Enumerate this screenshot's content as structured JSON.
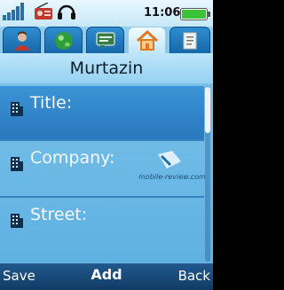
{
  "status_bar": {
    "time": "11:06"
  },
  "tabs": [
    {
      "icon": "contact-person-icon"
    },
    {
      "icon": "globe-icon"
    },
    {
      "icon": "message-icon"
    },
    {
      "icon": "home-icon",
      "active": true
    },
    {
      "icon": "note-icon"
    }
  ],
  "title": "Murtazin",
  "fields": [
    {
      "label": "Title:",
      "icon": "building-icon",
      "selected": true
    },
    {
      "label": "Company:",
      "icon": "building-icon"
    },
    {
      "label": "Street:",
      "icon": "building-icon"
    }
  ],
  "watermark": "mobile-review.com",
  "softkeys": {
    "left": "Save",
    "middle": "Add",
    "right": "Back"
  },
  "colors": {
    "accent": "#2a78bf",
    "battery": "#39c23a"
  }
}
